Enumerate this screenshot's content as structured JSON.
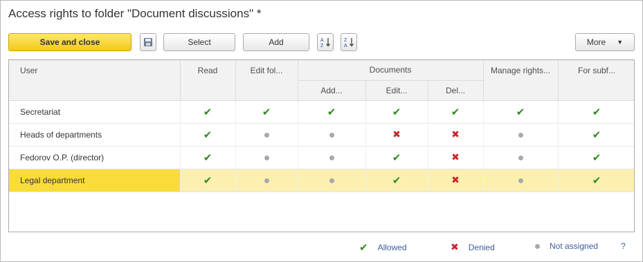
{
  "window": {
    "title": "Access rights to folder \"Document discussions\" *"
  },
  "toolbar": {
    "save_close_label": "Save and close",
    "pick_label": "Select",
    "add_label": "Add",
    "more_label": "More",
    "save_icon": "floppy-disk-icon",
    "sort_asc_icon": "sort-ascending-icon",
    "sort_desc_icon": "sort-descending-icon"
  },
  "grid": {
    "headers": {
      "user": "User",
      "read": "Read",
      "change_folder": "Edit fol...",
      "documents": "Documents",
      "add": "Add...",
      "edit": "Edit...",
      "delete": "Del...",
      "manage_rights": "Manage rights...",
      "subfolders": "For subf..."
    },
    "rows": [
      {
        "name": "Secretariat",
        "rights": [
          "allow",
          "allow",
          "allow",
          "allow",
          "allow",
          "allow",
          "allow"
        ]
      },
      {
        "name": "Heads of departments",
        "rights": [
          "allow",
          "none",
          "none",
          "deny",
          "deny",
          "none",
          "allow"
        ]
      },
      {
        "name": "Fedorov O.P. (director)",
        "rights": [
          "allow",
          "none",
          "none",
          "allow",
          "deny",
          "none",
          "allow"
        ]
      },
      {
        "name": "Legal department",
        "rights": [
          "allow",
          "none",
          "none",
          "allow",
          "deny",
          "none",
          "allow"
        ],
        "selected": true
      }
    ]
  },
  "legend": {
    "allowed": "Allowed",
    "denied": "Denied",
    "not_assigned": "Not assigned",
    "help": "?"
  },
  "colors": {
    "accent": "#f4c91c",
    "selected_row": "#fbf0b0",
    "allow": "#2f8b1f",
    "deny": "#c62828",
    "none": "#a9a9a9",
    "link": "#3a5d9c"
  }
}
